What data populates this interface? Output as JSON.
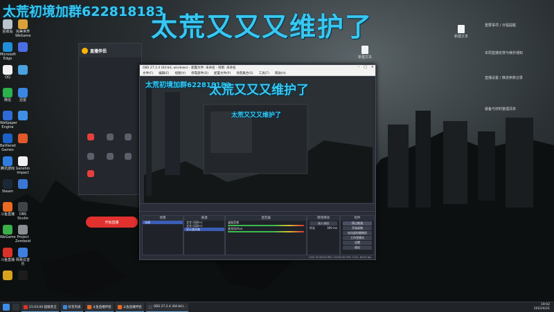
{
  "overlay": {
    "left_text": "太荒初境加群622818183",
    "center_text": "太荒又又又维护了"
  },
  "desktop_icons": [
    {
      "label": "回收站",
      "color": "#b9c4cc"
    },
    {
      "label": "完美世界 WeGame",
      "color": "#d8a23a"
    },
    {
      "label": "Microsoft Edge",
      "color": "#1f8fd6"
    },
    {
      "label": "",
      "color": "#4b6fe2"
    },
    {
      "label": "QQ",
      "color": "#f1f1f1"
    },
    {
      "label": "",
      "color": "#4aa3e0"
    },
    {
      "label": "微信",
      "color": "#2ab24d"
    },
    {
      "label": "迅雷",
      "color": "#3a86e2"
    },
    {
      "label": "Wallpaper Engine",
      "color": "#2f6ad6"
    },
    {
      "label": "",
      "color": "#3e8fe6"
    },
    {
      "label": "Battlenet Games",
      "color": "#1a62c7"
    },
    {
      "label": "",
      "color": "#e05a2a"
    },
    {
      "label": "腾讯游戏",
      "color": "#2f7de0"
    },
    {
      "label": "Genshin Impact",
      "color": "#f0f0f0"
    },
    {
      "label": "Steam",
      "color": "#1b2838"
    },
    {
      "label": "",
      "color": "#3a77d4"
    },
    {
      "label": "斗鱼直播",
      "color": "#e96a20"
    },
    {
      "label": "OBS Studio",
      "color": "#404348"
    },
    {
      "label": "WeGame",
      "color": "#3ab04a"
    },
    {
      "label": "Project Zomboid",
      "color": "#8a8f94"
    },
    {
      "label": "斗鱼直播",
      "color": "#d9322b"
    },
    {
      "label": "网易云音乐",
      "color": "#3e7fe0"
    },
    {
      "label": "",
      "color": "#d6a21e"
    },
    {
      "label": "",
      "color": "#1c1c1c"
    }
  ],
  "right_notes": {
    "doc1": "新建文本",
    "doc2": "新建文本",
    "note1": "重要事项 / 日程提醒",
    "note2": "本周直播安排与维护通知",
    "note3": "直播设置 / 推流参数记录",
    "note4": "装备与材料整理清单"
  },
  "companion": {
    "app_name": "直播伴侣",
    "start_button": "开始直播"
  },
  "obs": {
    "title": "OBS 27.2.4 (64-bit, windows) - 配置文件: 未命名 - 场景: 未命名",
    "menus": [
      "文件(F)",
      "编辑(E)",
      "视图(V)",
      "停靠部件(D)",
      "配置文件(P)",
      "场景集合(S)",
      "工具(T)",
      "帮助(H)"
    ],
    "docks": {
      "scenes": "场景",
      "sources": "来源",
      "mixer": "混音器",
      "transitions": "转场特效",
      "controls": "控件"
    },
    "scene_items": [
      "场景"
    ],
    "source_items": [
      "文字 (GDI+)",
      "文字 (GDI+)",
      "显示器采集"
    ],
    "mixer_items": [
      "桌面音频",
      "麦克风/Aux"
    ],
    "transition": "淡入淡出",
    "duration_label": "时长",
    "duration": "300 ms",
    "control_buttons": [
      "停止推流",
      "开始录制",
      "启动虚拟摄像机",
      "工作室模式",
      "设置",
      "退出"
    ],
    "status": "LIVE: 00:00:00   REC: 00:00:00   CPU: 3.2%, 60.00 fps"
  },
  "taskbar": {
    "items": [
      "21:03:00  超级卷王",
      "好友列表",
      "斗鱼直播伴侣",
      "斗鱼直播伴侣",
      "OBS 27.2.4 (64-bit)..."
    ],
    "time": "19:02",
    "date": "2022/4/21"
  }
}
